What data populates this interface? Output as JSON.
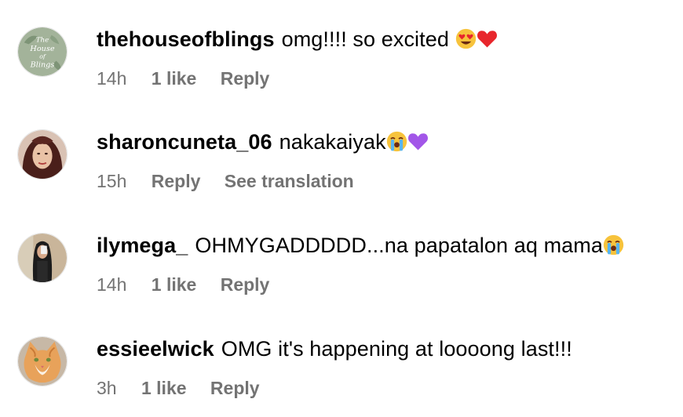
{
  "comments": [
    {
      "username": "thehouseofblings",
      "text": "omg!!!! so excited ",
      "emojis": [
        "heart-eyes-face",
        "red-heart"
      ],
      "time": "14h",
      "likes": "1 like",
      "reply": "Reply",
      "avatar_text": [
        "The",
        "House",
        "of",
        "Blings"
      ]
    },
    {
      "username": "sharoncuneta_06",
      "text": "nakakaiyak",
      "emojis": [
        "loudly-crying-face",
        "purple-heart"
      ],
      "time": "15h",
      "reply": "Reply",
      "translation": "See translation"
    },
    {
      "username": "ilymega_",
      "text": "OHMYGADDDDD...na papatalon aq mama",
      "emojis": [
        "loudly-crying-face"
      ],
      "time": "14h",
      "likes": "1 like",
      "reply": "Reply"
    },
    {
      "username": "essieelwick",
      "text": "OMG it's happening at loooong last!!!",
      "emojis": [],
      "time": "3h",
      "likes": "1 like",
      "reply": "Reply"
    }
  ],
  "colors": {
    "text": "#000000",
    "meta": "#737373",
    "heart_red": "#e8262c",
    "heart_purple": "#a256e8",
    "emoji_yellow": "#f7c33c"
  }
}
